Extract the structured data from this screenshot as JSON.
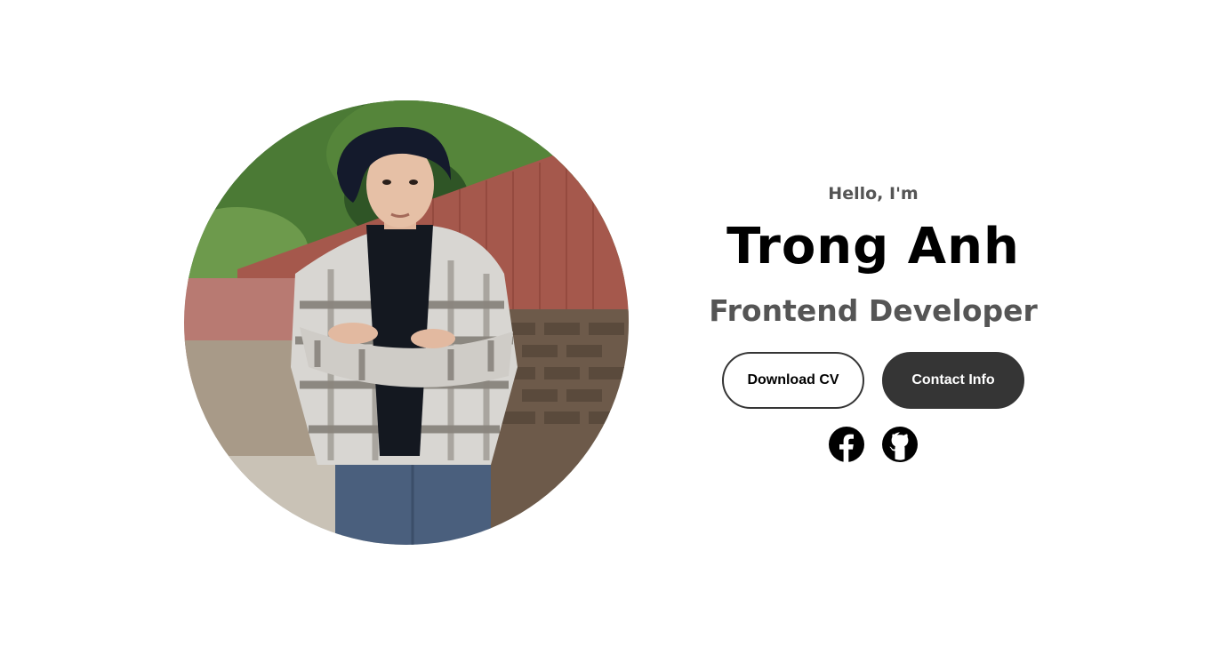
{
  "profile": {
    "image_alt": "profile picture"
  },
  "intro": {
    "greeting": "Hello, I'm",
    "name": "Trong Anh",
    "role": "Frontend Developer"
  },
  "buttons": {
    "download_cv": "Download CV",
    "contact_info": "Contact Info"
  },
  "socials": [
    {
      "icon": "facebook-icon"
    },
    {
      "icon": "github-icon"
    }
  ],
  "colors": {
    "background": "#ffffff",
    "primary_dark": "#353535",
    "text_muted": "#555555",
    "text_main": "#000000"
  }
}
